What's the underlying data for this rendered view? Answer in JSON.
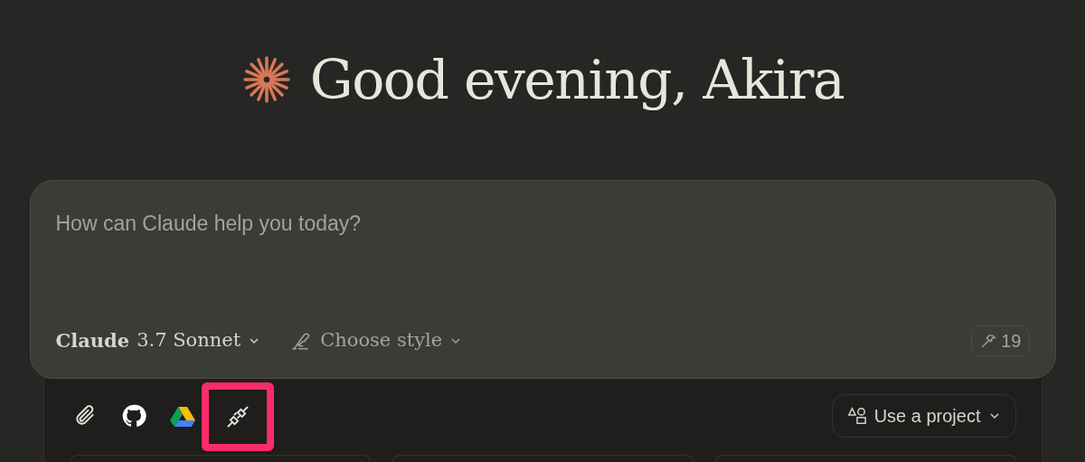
{
  "greeting": "Good evening, Akira",
  "prompt": {
    "placeholder": "How can Claude help you today?"
  },
  "model": {
    "name": "Claude",
    "version": "3.7 Sonnet"
  },
  "style": {
    "label": "Choose style"
  },
  "tools_count": "19",
  "attachments": [
    {
      "kind": "paperclip",
      "highlighted": false
    },
    {
      "kind": "github",
      "highlighted": false
    },
    {
      "kind": "drive",
      "highlighted": false
    },
    {
      "kind": "plug",
      "highlighted": true
    }
  ],
  "project_button": "Use a project"
}
